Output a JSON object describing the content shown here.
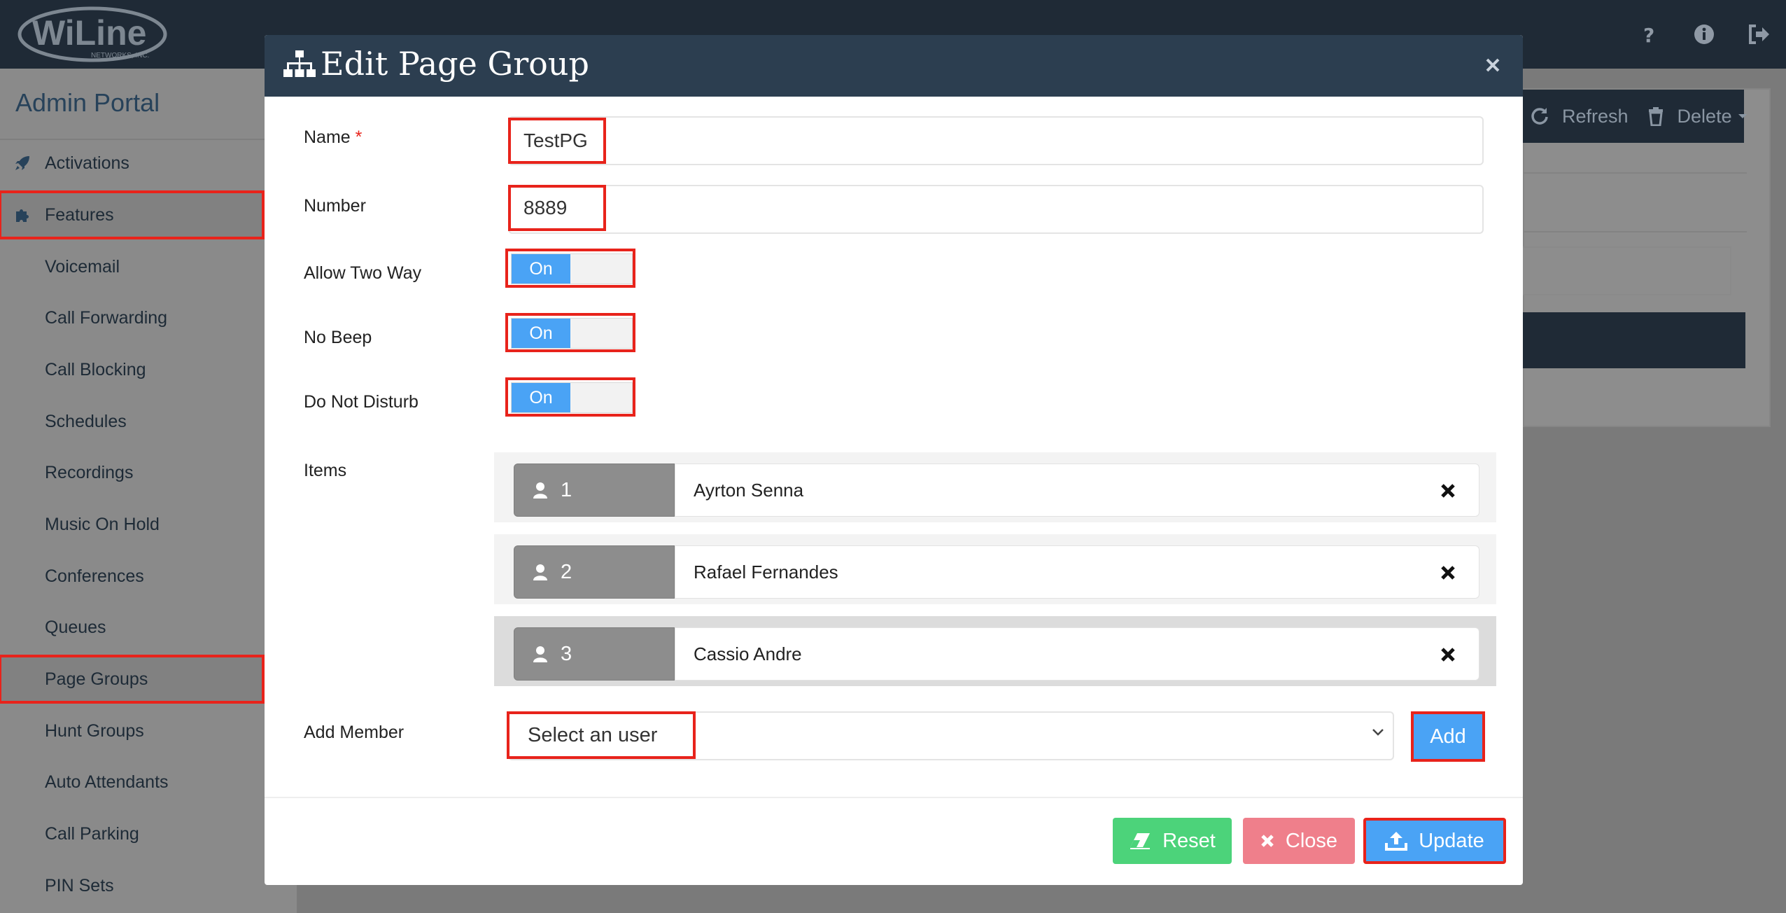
{
  "logo": {
    "wordmark": "WiLine",
    "tagline": "NETWORKS, INC."
  },
  "topbar": {
    "icons": [
      "help-icon",
      "info-icon",
      "logout-icon"
    ]
  },
  "sidebar": {
    "title": "Admin Portal",
    "items": [
      {
        "label": "Activations",
        "icon": "rocket-icon"
      },
      {
        "label": "Features",
        "icon": "puzzle-icon"
      },
      {
        "label": "Voicemail"
      },
      {
        "label": "Call Forwarding"
      },
      {
        "label": "Call Blocking"
      },
      {
        "label": "Schedules"
      },
      {
        "label": "Recordings"
      },
      {
        "label": "Music On Hold"
      },
      {
        "label": "Conferences"
      },
      {
        "label": "Queues"
      },
      {
        "label": "Page Groups"
      },
      {
        "label": "Hunt Groups"
      },
      {
        "label": "Auto Attendants"
      },
      {
        "label": "Call Parking"
      },
      {
        "label": "PIN Sets"
      }
    ]
  },
  "background_toolbar": {
    "refresh_label": "Refresh",
    "delete_label": "Delete"
  },
  "modal": {
    "title": "Edit Page Group",
    "fields": {
      "name_label": "Name",
      "required_mark": "*",
      "name_value": "TestPG",
      "number_label": "Number",
      "number_value": "8889",
      "allow_two_way_label": "Allow Two Way",
      "allow_two_way_state": "On",
      "no_beep_label": "No Beep",
      "no_beep_state": "On",
      "dnd_label": "Do Not Disturb",
      "dnd_state": "On",
      "items_label": "Items",
      "add_member_label": "Add Member",
      "add_member_placeholder": "Select an user",
      "add_button": "Add"
    },
    "items": [
      {
        "number": "1",
        "name": "Ayrton Senna"
      },
      {
        "number": "2",
        "name": "Rafael Fernandes"
      },
      {
        "number": "3",
        "name": "Cassio Andre"
      }
    ],
    "footer": {
      "reset": "Reset",
      "close": "Close",
      "update": "Update"
    }
  },
  "colors": {
    "header": "#2c3e50",
    "primary": "#4aa3f5",
    "success": "#4cd37a",
    "danger": "#ef7f8b",
    "highlight": "#e8231b"
  }
}
